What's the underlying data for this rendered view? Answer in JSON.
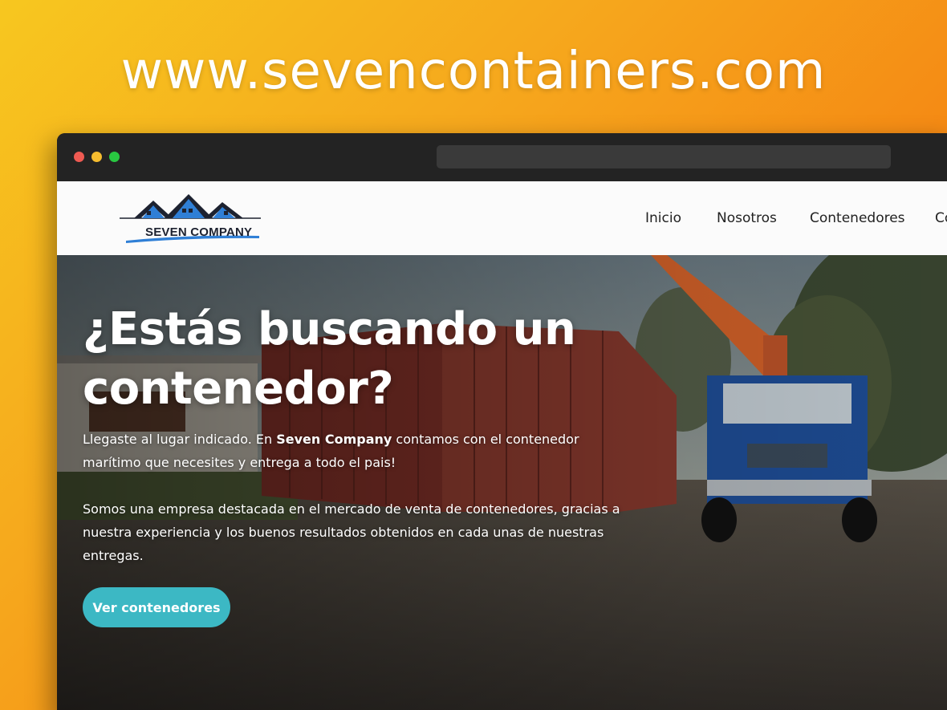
{
  "banner": {
    "url_text": "www.sevencontainers.com"
  },
  "site": {
    "logo_text": "SEVEN COMPANY",
    "nav": [
      "Inicio",
      "Nosotros",
      "Contenedores",
      "Co"
    ]
  },
  "hero": {
    "title_line1": "¿Estás buscando un",
    "title_line2": "contenedor?",
    "p1_before": "Llegaste al lugar indicado. En ",
    "p1_bold": "Seven Company",
    "p1_after": " contamos con el contenedor marítimo que necesites y entrega a todo el pais!",
    "p2": "Somos una empresa destacada en el mercado de venta de contenedores, gracias a nuestra experiencia y los buenos resultados obtenidos en cada unas de nuestras entregas.",
    "cta_label": "Ver contenedores"
  },
  "colors": {
    "accent": "#3cb8c4",
    "background_gradient_start": "#f7c71f",
    "background_gradient_end": "#f26a10",
    "logo_blue": "#2f7fd6"
  }
}
